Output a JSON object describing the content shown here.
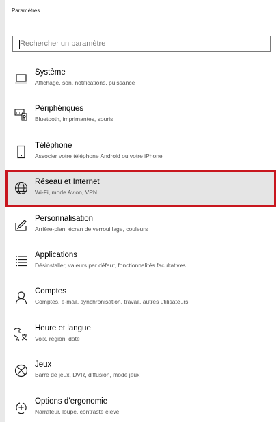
{
  "window": {
    "title": "Paramètres"
  },
  "search": {
    "placeholder": "Rechercher un paramètre"
  },
  "colors": {
    "selection_border": "#c8161e",
    "selection_bg": "#e5e5e5"
  },
  "items": [
    {
      "label": "Système",
      "desc": "Affichage, son, notifications, puissance",
      "icon": "laptop-icon"
    },
    {
      "label": "Périphériques",
      "desc": "Bluetooth, imprimantes, souris",
      "icon": "devices-icon"
    },
    {
      "label": "Téléphone",
      "desc": "Associer votre téléphone Android ou votre iPhone",
      "icon": "phone-icon"
    },
    {
      "label": "Réseau et Internet",
      "desc": "Wi-Fi, mode Avion, VPN",
      "icon": "globe-icon",
      "selected": true
    },
    {
      "label": "Personnalisation",
      "desc": "Arrière-plan, écran de verrouillage, couleurs",
      "icon": "pen-tablet-icon"
    },
    {
      "label": "Applications",
      "desc": "Désinstaller, valeurs par défaut, fonctionnalités facultatives",
      "icon": "apps-list-icon"
    },
    {
      "label": "Comptes",
      "desc": "Comptes, e-mail, synchronisation, travail, autres utilisateurs",
      "icon": "person-icon"
    },
    {
      "label": "Heure et langue",
      "desc": "Voix, région, date",
      "icon": "time-language-icon"
    },
    {
      "label": "Jeux",
      "desc": "Barre de jeux, DVR, diffusion, mode jeux",
      "icon": "xbox-icon"
    },
    {
      "label": "Options d’ergonomie",
      "desc": "Narrateur, loupe, contraste élevé",
      "icon": "ease-of-access-icon"
    }
  ]
}
